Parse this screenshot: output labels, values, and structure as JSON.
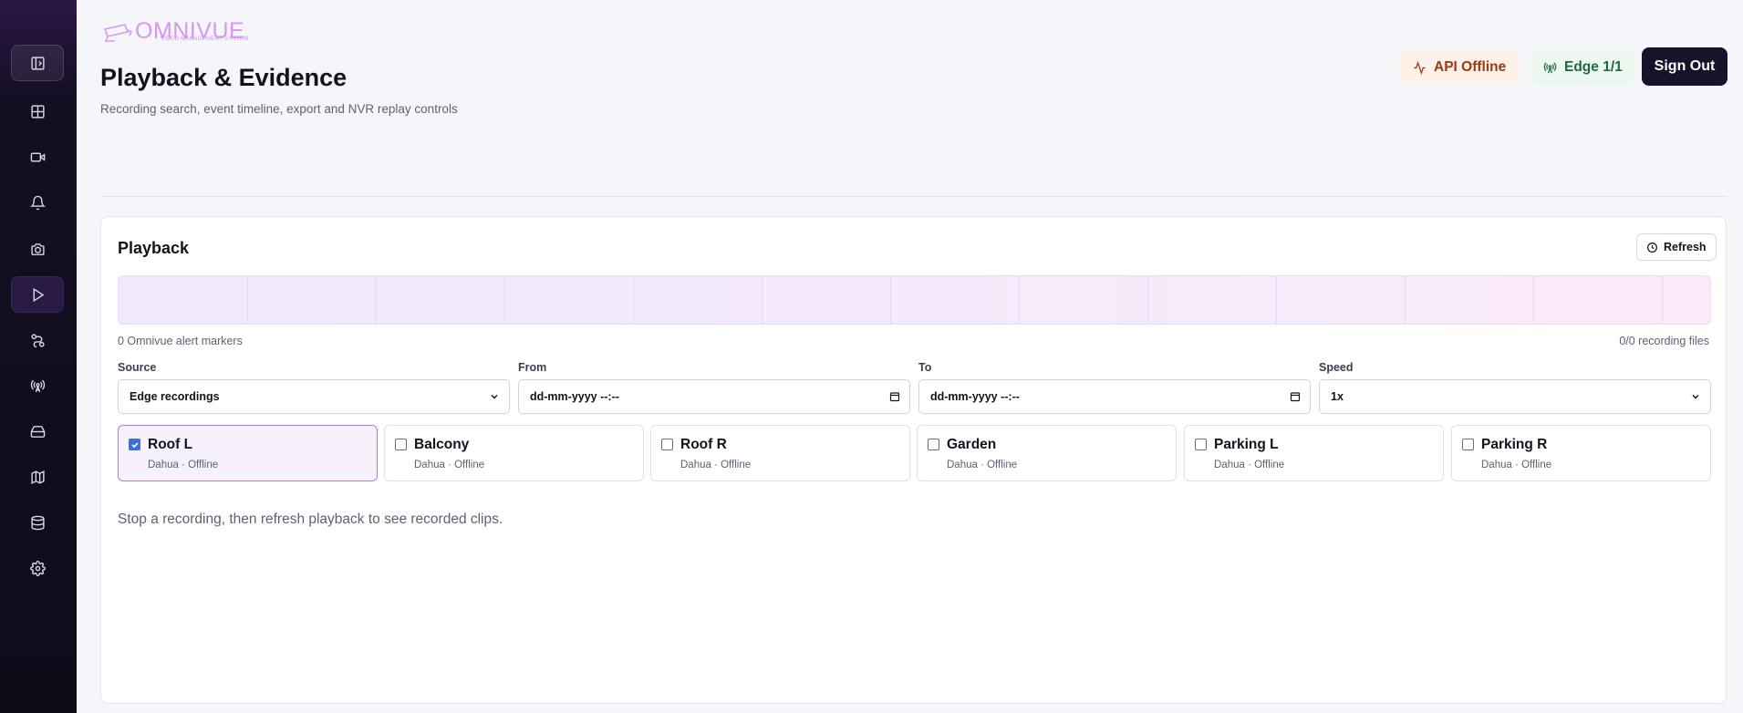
{
  "app": {
    "logo_text": "OMNIVUE",
    "logo_subtitle": "VIDEO MANAGEMENT SYSTEM",
    "colors": {
      "brand": "#d896f0",
      "sidebar": "#0f0c1a",
      "accent_select": "#a77ee6"
    }
  },
  "sidebar": {
    "items": [
      {
        "name": "sidebar-toggle",
        "icon": "sidebar-panel-icon"
      },
      {
        "name": "dashboard",
        "icon": "grid-icon"
      },
      {
        "name": "cameras",
        "icon": "video-camera-icon"
      },
      {
        "name": "alerts",
        "icon": "bell-icon"
      },
      {
        "name": "snapshots",
        "icon": "camera-icon"
      },
      {
        "name": "playback",
        "icon": "play-icon",
        "active": true
      },
      {
        "name": "workflows",
        "icon": "route-icon"
      },
      {
        "name": "edge",
        "icon": "antenna-icon"
      },
      {
        "name": "storage",
        "icon": "hard-drive-icon"
      },
      {
        "name": "map",
        "icon": "map-icon"
      },
      {
        "name": "database",
        "icon": "database-icon"
      },
      {
        "name": "settings",
        "icon": "gear-icon"
      }
    ]
  },
  "header": {
    "title": "Playback & Evidence",
    "subtitle": "Recording search, event timeline, export and NVR replay controls",
    "api_status": "API Offline",
    "edge_status": "Edge 1/1",
    "signout_label": "Sign Out"
  },
  "playback": {
    "title": "Playback",
    "refresh_label": "Refresh",
    "alert_markers": "0 Omnivue alert markers",
    "recording_files": "0/0 recording files",
    "source": {
      "label": "Source",
      "value": "Edge recordings"
    },
    "from": {
      "label": "From",
      "value": "dd-mm-yyyy --:--"
    },
    "to": {
      "label": "To",
      "value": "dd-mm-yyyy --:--"
    },
    "speed": {
      "label": "Speed",
      "value": "1x"
    },
    "cameras": [
      {
        "name": "Roof L",
        "meta": "Dahua · Offline",
        "checked": true
      },
      {
        "name": "Balcony",
        "meta": "Dahua · Offline",
        "checked": false
      },
      {
        "name": "Roof R",
        "meta": "Dahua · Offline",
        "checked": false
      },
      {
        "name": "Garden",
        "meta": "Dahua · Offline",
        "checked": false
      },
      {
        "name": "Parking L",
        "meta": "Dahua · Offline",
        "checked": false
      },
      {
        "name": "Parking R",
        "meta": "Dahua · Offline",
        "checked": false
      }
    ],
    "hint": "Stop a recording, then refresh playback to see recorded clips."
  }
}
